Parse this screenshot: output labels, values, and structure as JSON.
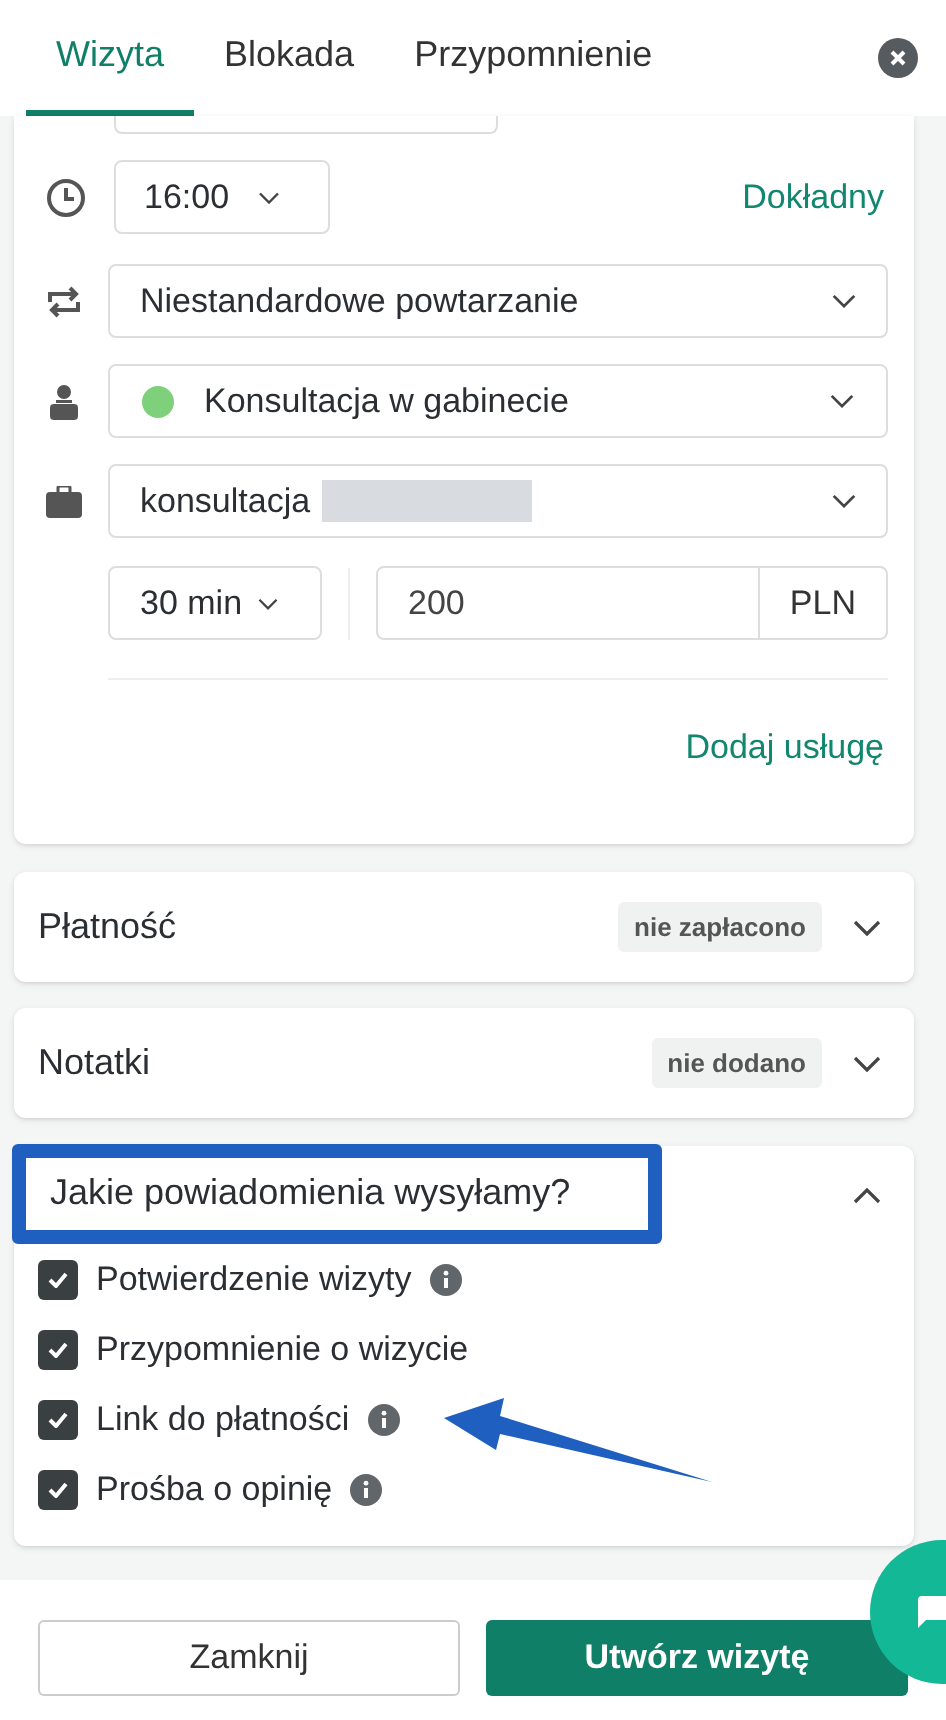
{
  "tabs": [
    {
      "label": "Wizyta",
      "selected": true
    },
    {
      "label": "Blokada",
      "selected": false
    },
    {
      "label": "Przypomnienie",
      "selected": false
    }
  ],
  "form": {
    "time": "16:00",
    "time_mode": "Dokładny",
    "repeat": "Niestandardowe powtarzanie",
    "location": {
      "label": "Konsultacja w gabinecie",
      "color": "#7ed07a"
    },
    "service": "konsultacja",
    "duration": "30 min",
    "price": "200",
    "currency": "PLN",
    "add_service": "Dodaj usługę"
  },
  "sections": [
    {
      "title": "Płatność",
      "badge": "nie zapłacono",
      "expanded": false
    },
    {
      "title": "Notatki",
      "badge": "nie dodano",
      "expanded": false
    }
  ],
  "notifications": {
    "title": "Jakie powiadomienia wysyłamy?",
    "expanded": true,
    "highlighted": true,
    "items": [
      {
        "label": "Potwierdzenie wizyty",
        "checked": true,
        "info": true
      },
      {
        "label": "Przypomnienie o wizycie",
        "checked": true,
        "info": false
      },
      {
        "label": "Link do płatności",
        "checked": true,
        "info": true
      },
      {
        "label": "Prośba o opinię",
        "checked": true,
        "info": true
      }
    ]
  },
  "footer": {
    "buttons": [
      "Zamknij",
      "Utwórz wizytę"
    ]
  }
}
